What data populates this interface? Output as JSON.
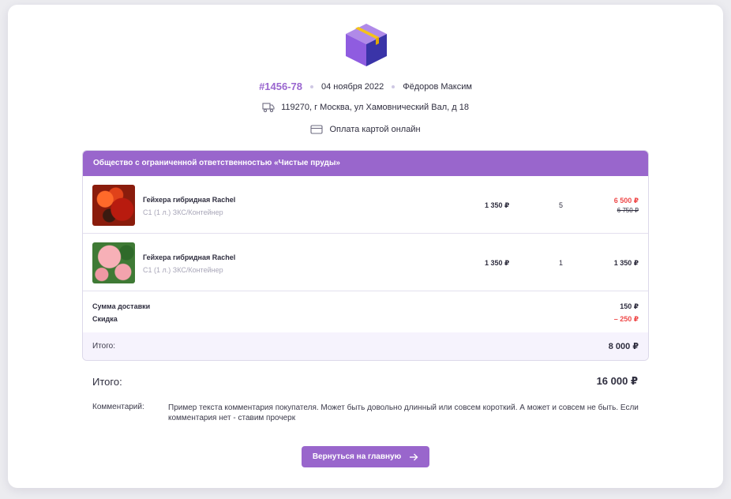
{
  "order": {
    "number": "#1456-78",
    "date": "04 ноября 2022",
    "customer": "Фёдоров Максим",
    "address": "119270, г Москва, ул Хамовнический Вал, д 18",
    "payment": "Оплата картой онлайн"
  },
  "icons": {
    "logo": "package-box-icon",
    "address": "truck-icon",
    "payment": "credit-card-icon",
    "button": "arrow-right-icon"
  },
  "colors": {
    "accent": "#9966cc",
    "discount_red": "#ef4a4a",
    "subtotal_bg": "#f6f3fd"
  },
  "seller": {
    "name": "Общество с ограниченной ответственностью «Чистые пруды»",
    "items": [
      {
        "name": "Гейхера гибридная Rachel",
        "desc": "С1 (1 л.) ЗКС/Контейнер",
        "price": "1 350 ₽",
        "qty": "5",
        "total": "6 500 ₽",
        "total_old": "6 750 ₽"
      },
      {
        "name": "Гейхера гибридная Rachel",
        "desc": "С1 (1 л.) ЗКС/Контейнер",
        "price": "1 350 ₽",
        "qty": "1",
        "total": "1 350 ₽"
      }
    ],
    "delivery_label": "Сумма доставки",
    "delivery_value": "150 ₽",
    "discount_label": "Скидка",
    "discount_value": "– 250 ₽",
    "subtotal_label": "Итого:",
    "subtotal_value": "8 000 ₽"
  },
  "grand_total": {
    "label": "Итого:",
    "value": "16 000 ₽"
  },
  "comment": {
    "label": "Комментарий:",
    "text": "Пример текста комментария покупателя. Может быть довольно длинный или совсем короткий. А может и совсем не быть. Если комментария нет - ставим прочерк"
  },
  "back_button": {
    "label": "Вернуться на главную"
  }
}
